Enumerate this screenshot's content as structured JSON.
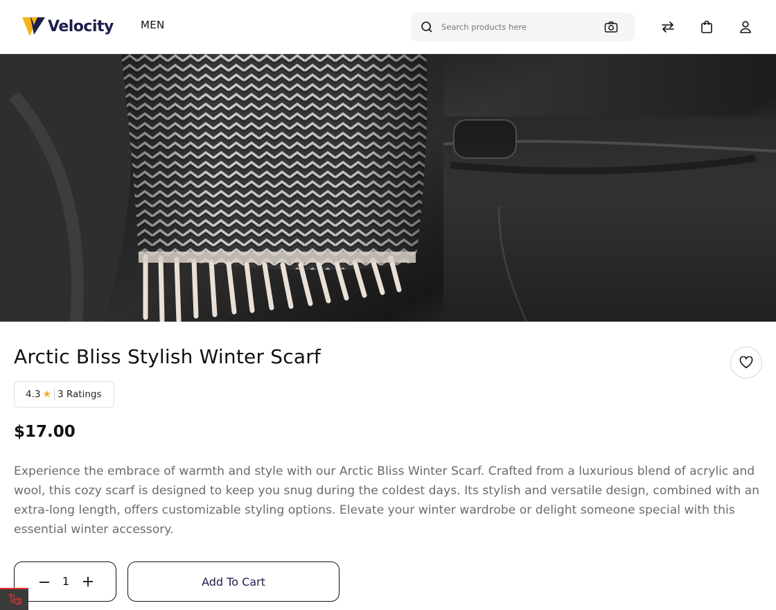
{
  "header": {
    "brand": "Velocity",
    "nav": {
      "men_label": "MEN"
    },
    "search": {
      "placeholder": "Search products here"
    },
    "icons": [
      "search-icon",
      "camera-icon",
      "compare-icon",
      "bag-icon",
      "user-icon"
    ]
  },
  "product": {
    "title": "Arctic Bliss Stylish Winter Scarf",
    "rating": {
      "value": "4.3",
      "star": "★",
      "count_label": "3 Ratings"
    },
    "price": "$17.00",
    "description": "Experience the embrace of warmth and style with our Arctic Bliss Winter Scarf. Crafted from a luxurious blend of acrylic and wool, this cozy scarf is designed to keep you snug during the coldest days. Its stylish and versatile design, combined with an extra-long length, offers customizable styling options. Elevate your winter wardrobe or delight someone special with this essential winter accessory.",
    "quantity": "1",
    "add_to_cart_label": "Add To Cart"
  },
  "colors": {
    "brand_navy": "#1b1f4a",
    "logo_yellow": "#f5b31b",
    "star": "#f5a623",
    "description_text": "#6b6b6b"
  }
}
